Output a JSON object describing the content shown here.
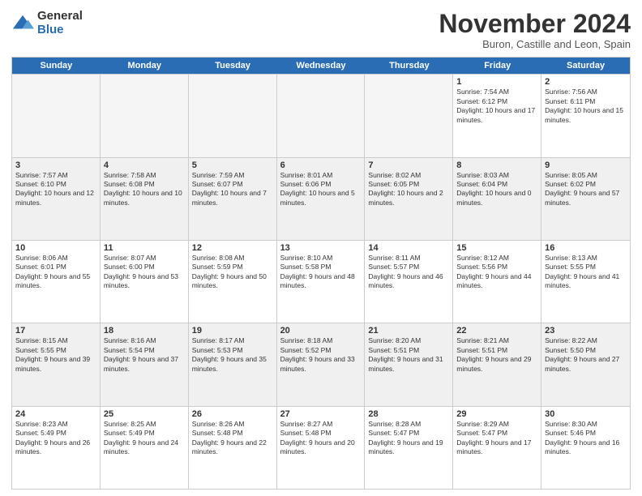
{
  "logo": {
    "general": "General",
    "blue": "Blue"
  },
  "title": "November 2024",
  "subtitle": "Buron, Castille and Leon, Spain",
  "header": {
    "days": [
      "Sunday",
      "Monday",
      "Tuesday",
      "Wednesday",
      "Thursday",
      "Friday",
      "Saturday"
    ]
  },
  "weeks": [
    [
      {
        "day": "",
        "info": "",
        "empty": true
      },
      {
        "day": "",
        "info": "",
        "empty": true
      },
      {
        "day": "",
        "info": "",
        "empty": true
      },
      {
        "day": "",
        "info": "",
        "empty": true
      },
      {
        "day": "",
        "info": "",
        "empty": true
      },
      {
        "day": "1",
        "info": "Sunrise: 7:54 AM\nSunset: 6:12 PM\nDaylight: 10 hours and 17 minutes."
      },
      {
        "day": "2",
        "info": "Sunrise: 7:56 AM\nSunset: 6:11 PM\nDaylight: 10 hours and 15 minutes."
      }
    ],
    [
      {
        "day": "3",
        "info": "Sunrise: 7:57 AM\nSunset: 6:10 PM\nDaylight: 10 hours and 12 minutes."
      },
      {
        "day": "4",
        "info": "Sunrise: 7:58 AM\nSunset: 6:08 PM\nDaylight: 10 hours and 10 minutes."
      },
      {
        "day": "5",
        "info": "Sunrise: 7:59 AM\nSunset: 6:07 PM\nDaylight: 10 hours and 7 minutes."
      },
      {
        "day": "6",
        "info": "Sunrise: 8:01 AM\nSunset: 6:06 PM\nDaylight: 10 hours and 5 minutes."
      },
      {
        "day": "7",
        "info": "Sunrise: 8:02 AM\nSunset: 6:05 PM\nDaylight: 10 hours and 2 minutes."
      },
      {
        "day": "8",
        "info": "Sunrise: 8:03 AM\nSunset: 6:04 PM\nDaylight: 10 hours and 0 minutes."
      },
      {
        "day": "9",
        "info": "Sunrise: 8:05 AM\nSunset: 6:02 PM\nDaylight: 9 hours and 57 minutes."
      }
    ],
    [
      {
        "day": "10",
        "info": "Sunrise: 8:06 AM\nSunset: 6:01 PM\nDaylight: 9 hours and 55 minutes."
      },
      {
        "day": "11",
        "info": "Sunrise: 8:07 AM\nSunset: 6:00 PM\nDaylight: 9 hours and 53 minutes."
      },
      {
        "day": "12",
        "info": "Sunrise: 8:08 AM\nSunset: 5:59 PM\nDaylight: 9 hours and 50 minutes."
      },
      {
        "day": "13",
        "info": "Sunrise: 8:10 AM\nSunset: 5:58 PM\nDaylight: 9 hours and 48 minutes."
      },
      {
        "day": "14",
        "info": "Sunrise: 8:11 AM\nSunset: 5:57 PM\nDaylight: 9 hours and 46 minutes."
      },
      {
        "day": "15",
        "info": "Sunrise: 8:12 AM\nSunset: 5:56 PM\nDaylight: 9 hours and 44 minutes."
      },
      {
        "day": "16",
        "info": "Sunrise: 8:13 AM\nSunset: 5:55 PM\nDaylight: 9 hours and 41 minutes."
      }
    ],
    [
      {
        "day": "17",
        "info": "Sunrise: 8:15 AM\nSunset: 5:55 PM\nDaylight: 9 hours and 39 minutes."
      },
      {
        "day": "18",
        "info": "Sunrise: 8:16 AM\nSunset: 5:54 PM\nDaylight: 9 hours and 37 minutes."
      },
      {
        "day": "19",
        "info": "Sunrise: 8:17 AM\nSunset: 5:53 PM\nDaylight: 9 hours and 35 minutes."
      },
      {
        "day": "20",
        "info": "Sunrise: 8:18 AM\nSunset: 5:52 PM\nDaylight: 9 hours and 33 minutes."
      },
      {
        "day": "21",
        "info": "Sunrise: 8:20 AM\nSunset: 5:51 PM\nDaylight: 9 hours and 31 minutes."
      },
      {
        "day": "22",
        "info": "Sunrise: 8:21 AM\nSunset: 5:51 PM\nDaylight: 9 hours and 29 minutes."
      },
      {
        "day": "23",
        "info": "Sunrise: 8:22 AM\nSunset: 5:50 PM\nDaylight: 9 hours and 27 minutes."
      }
    ],
    [
      {
        "day": "24",
        "info": "Sunrise: 8:23 AM\nSunset: 5:49 PM\nDaylight: 9 hours and 26 minutes."
      },
      {
        "day": "25",
        "info": "Sunrise: 8:25 AM\nSunset: 5:49 PM\nDaylight: 9 hours and 24 minutes."
      },
      {
        "day": "26",
        "info": "Sunrise: 8:26 AM\nSunset: 5:48 PM\nDaylight: 9 hours and 22 minutes."
      },
      {
        "day": "27",
        "info": "Sunrise: 8:27 AM\nSunset: 5:48 PM\nDaylight: 9 hours and 20 minutes."
      },
      {
        "day": "28",
        "info": "Sunrise: 8:28 AM\nSunset: 5:47 PM\nDaylight: 9 hours and 19 minutes."
      },
      {
        "day": "29",
        "info": "Sunrise: 8:29 AM\nSunset: 5:47 PM\nDaylight: 9 hours and 17 minutes."
      },
      {
        "day": "30",
        "info": "Sunrise: 8:30 AM\nSunset: 5:46 PM\nDaylight: 9 hours and 16 minutes."
      }
    ]
  ]
}
